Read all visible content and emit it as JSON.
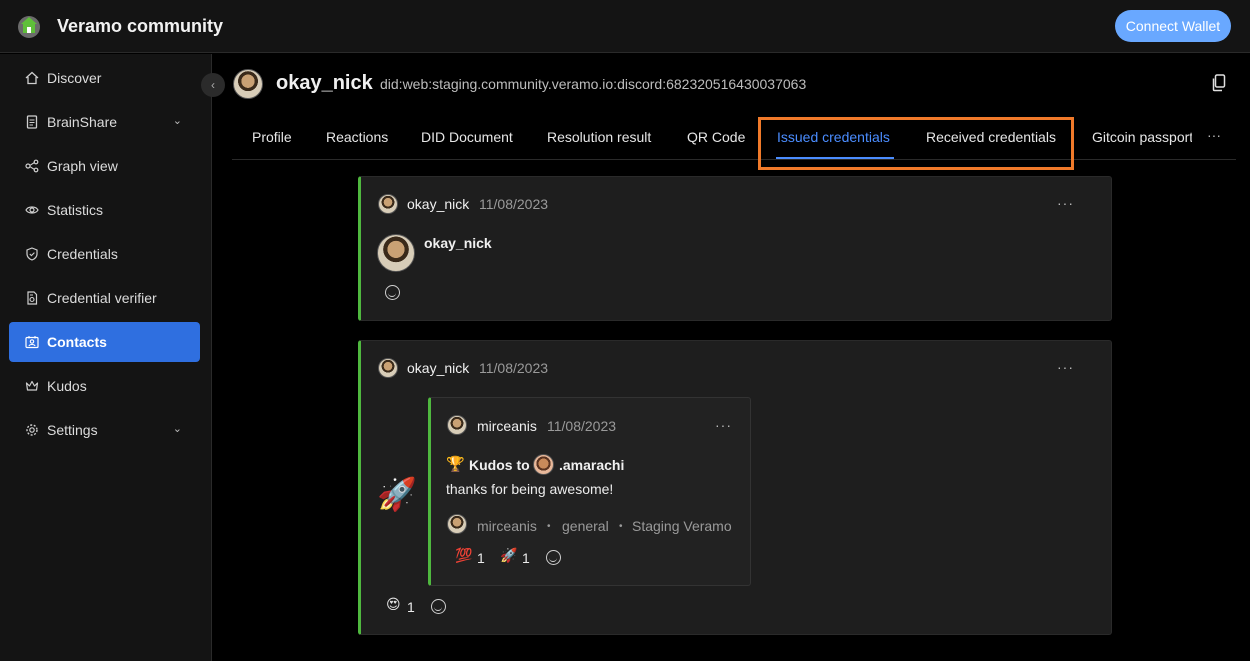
{
  "app": {
    "title": "Veramo community",
    "connect_label": "Connect Wallet"
  },
  "sidebar": {
    "items": [
      {
        "label": "Discover",
        "icon": "home-icon"
      },
      {
        "label": "BrainShare",
        "icon": "document-icon",
        "expandable": true
      },
      {
        "label": "Graph view",
        "icon": "graph-icon"
      },
      {
        "label": "Statistics",
        "icon": "eye-icon"
      },
      {
        "label": "Credentials",
        "icon": "shield-icon"
      },
      {
        "label": "Credential verifier",
        "icon": "file-check-icon"
      },
      {
        "label": "Contacts",
        "icon": "contacts-icon",
        "active": true
      },
      {
        "label": "Kudos",
        "icon": "crown-icon"
      },
      {
        "label": "Settings",
        "icon": "gear-icon",
        "expandable": true
      }
    ]
  },
  "profile": {
    "name": "okay_nick",
    "did": "did:web:staging.community.veramo.io:discord:682320516430037063"
  },
  "tabs": [
    "Profile",
    "Reactions",
    "DID Document",
    "Resolution result",
    "QR Code",
    "Issued credentials",
    "Received credentials",
    "Gitcoin passport"
  ],
  "active_tab": "Issued credentials",
  "tabs_more": "···",
  "cards": [
    {
      "user": "okay_nick",
      "date": "11/08/2023",
      "menu": "···",
      "body_name": "okay_nick"
    },
    {
      "user": "okay_nick",
      "date": "11/08/2023",
      "menu": "···",
      "rocket": "🚀",
      "inner": {
        "user": "mirceanis",
        "date": "11/08/2023",
        "menu": "···",
        "trophy": "🏆",
        "kudos_to": "Kudos to",
        "recipient": ".amarachi",
        "message": "thanks for being awesome!",
        "footer_user": "mirceanis",
        "sep": "•",
        "channel": "general",
        "server": "Staging Veramo",
        "reactions": [
          {
            "emoji": "💯",
            "count": "1"
          },
          {
            "emoji": "🚀",
            "count": "1"
          }
        ]
      },
      "reactions": [
        {
          "emoji": "😍",
          "count": "1"
        }
      ]
    }
  ],
  "colors": {
    "accent": "#4b8dff",
    "active_nav": "#2f6fe0",
    "card_border": "#4fb83f",
    "highlight": "#f07a2a",
    "connect_button": "#69a8ff"
  }
}
